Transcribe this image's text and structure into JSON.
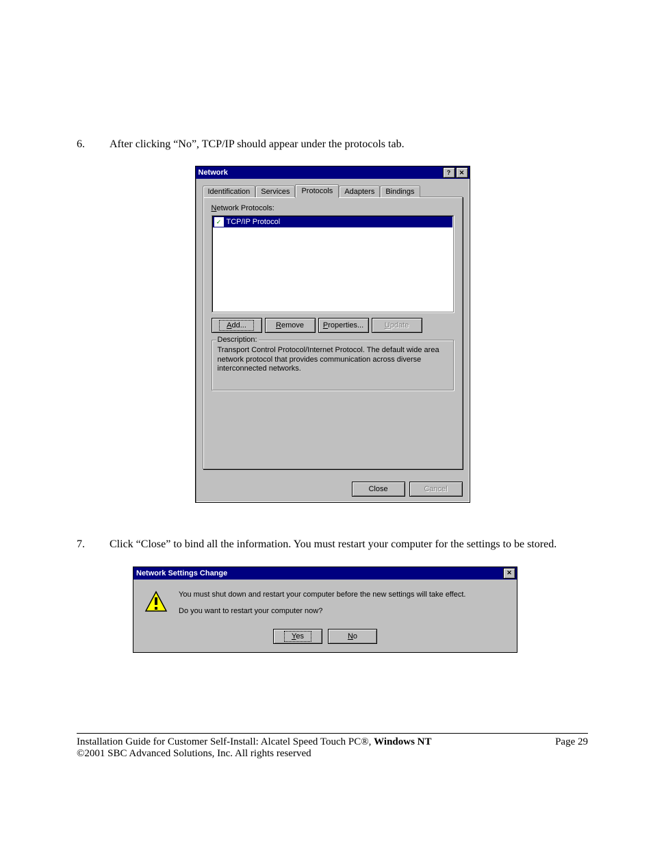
{
  "step6": {
    "num": "6.",
    "text": "After clicking “No”, TCP/IP should appear under the protocols tab."
  },
  "network_dialog": {
    "title": "Network",
    "tabs": {
      "identification": "Identification",
      "services": "Services",
      "protocols": "Protocols",
      "adapters": "Adapters",
      "bindings": "Bindings"
    },
    "protocols_label_prefix": "N",
    "protocols_label": "etwork Protocols:",
    "list_item": "TCP/IP Protocol",
    "buttons": {
      "add_u": "A",
      "add": "dd...",
      "remove_u": "R",
      "remove": "emove",
      "properties_u": "P",
      "properties": "roperties...",
      "update_u": "U",
      "update": "pdate"
    },
    "desc_legend": "Description:",
    "desc_text": "Transport Control Protocol/Internet Protocol. The default wide area network protocol that provides communication across diverse interconnected networks.",
    "close": "Close",
    "cancel": "Cancel"
  },
  "step7": {
    "num": "7.",
    "text": "Click “Close” to bind all the information. You must restart your computer for the settings to be stored."
  },
  "msgbox": {
    "title": "Network Settings Change",
    "line1": "You must shut down and restart your computer before the new settings will take effect.",
    "line2": "Do you want to restart your computer now?",
    "yes_u": "Y",
    "yes": "es",
    "no_u": "N",
    "no": "o"
  },
  "footer": {
    "line1_left": "Installation Guide for Customer Self-Install: Alcatel Speed Touch PC®, ",
    "line1_bold": "Windows NT",
    "line2": "©2001 SBC Advanced Solutions, Inc.  All rights reserved",
    "page": "Page 29"
  }
}
